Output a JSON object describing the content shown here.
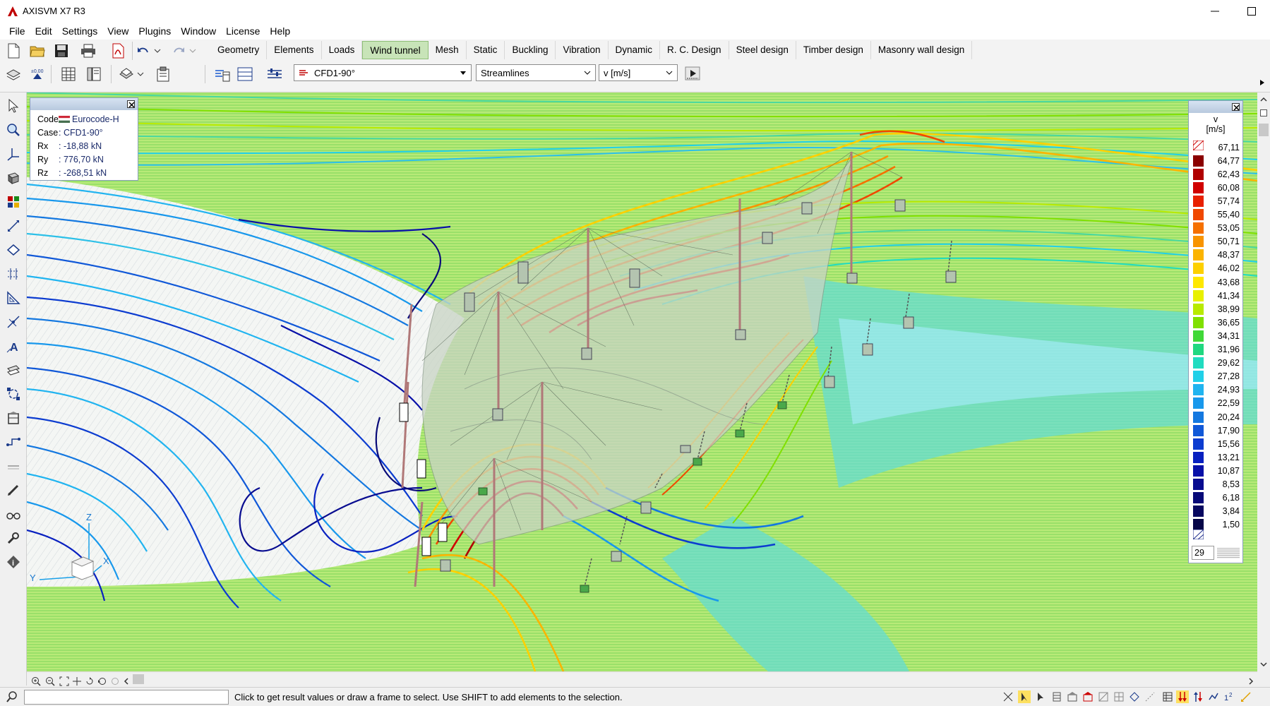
{
  "window": {
    "title": "AXISVM X7 R3",
    "accent": "#c00000"
  },
  "menu": {
    "items": [
      "File",
      "Edit",
      "Settings",
      "View",
      "Plugins",
      "Window",
      "License",
      "Help"
    ]
  },
  "tabs": [
    {
      "label": "Geometry"
    },
    {
      "label": "Elements"
    },
    {
      "label": "Loads"
    },
    {
      "label": "Wind tunnel",
      "active": true
    },
    {
      "label": "Mesh"
    },
    {
      "label": "Static"
    },
    {
      "label": "Buckling"
    },
    {
      "label": "Vibration"
    },
    {
      "label": "Dynamic"
    },
    {
      "label": "R. C. Design"
    },
    {
      "label": "Steel design"
    },
    {
      "label": "Timber design"
    },
    {
      "label": "Masonry wall design"
    }
  ],
  "toolbar": {
    "case_select": "CFD1-90°",
    "display_select": "Streamlines",
    "component_select": "v [m/s]"
  },
  "info_panel": {
    "rows": [
      {
        "key": "Code",
        "value": "Eurocode-H"
      },
      {
        "key": "Case",
        "value": ": CFD1-90°"
      },
      {
        "key": "Rx",
        "value": ": -18,88 kN"
      },
      {
        "key": "Ry",
        "value": ": 776,70 kN"
      },
      {
        "key": "Rz",
        "value": ": -268,51 kN"
      }
    ]
  },
  "legend": {
    "title_line1": "v",
    "title_line2": "[m/s]",
    "count": "29",
    "entries": [
      {
        "value": "67,11",
        "color": "#6b0000"
      },
      {
        "value": "64,77",
        "color": "#8a0000"
      },
      {
        "value": "62,43",
        "color": "#b00000"
      },
      {
        "value": "60,08",
        "color": "#d00000"
      },
      {
        "value": "57,74",
        "color": "#e82000"
      },
      {
        "value": "55,40",
        "color": "#f04800"
      },
      {
        "value": "53,05",
        "color": "#f57000"
      },
      {
        "value": "50,71",
        "color": "#f89400"
      },
      {
        "value": "48,37",
        "color": "#fbb400"
      },
      {
        "value": "46,02",
        "color": "#fdd000"
      },
      {
        "value": "43,68",
        "color": "#fee800"
      },
      {
        "value": "41,34",
        "color": "#e8f000"
      },
      {
        "value": "38,99",
        "color": "#b8ea00"
      },
      {
        "value": "36,65",
        "color": "#80e000"
      },
      {
        "value": "34,31",
        "color": "#40d838"
      },
      {
        "value": "31,96",
        "color": "#20d880"
      },
      {
        "value": "29,62",
        "color": "#20dcc0"
      },
      {
        "value": "27,28",
        "color": "#20d0e8"
      },
      {
        "value": "24,93",
        "color": "#20b4f0"
      },
      {
        "value": "22,59",
        "color": "#1898ec"
      },
      {
        "value": "20,24",
        "color": "#1478e0"
      },
      {
        "value": "17,90",
        "color": "#1058d8"
      },
      {
        "value": "15,56",
        "color": "#0c3cd0"
      },
      {
        "value": "13,21",
        "color": "#0820c0"
      },
      {
        "value": "10,87",
        "color": "#0810a8"
      },
      {
        "value": "8,53",
        "color": "#080c90"
      },
      {
        "value": "6,18",
        "color": "#080a78"
      },
      {
        "value": "3,84",
        "color": "#080860"
      },
      {
        "value": "1,50",
        "color": "#060648"
      }
    ]
  },
  "axes": {
    "z": "Z",
    "y": "Y",
    "x": "X"
  },
  "status": {
    "text": "Click to get result values or draw a frame to select. Use SHIFT to add elements to the selection."
  }
}
